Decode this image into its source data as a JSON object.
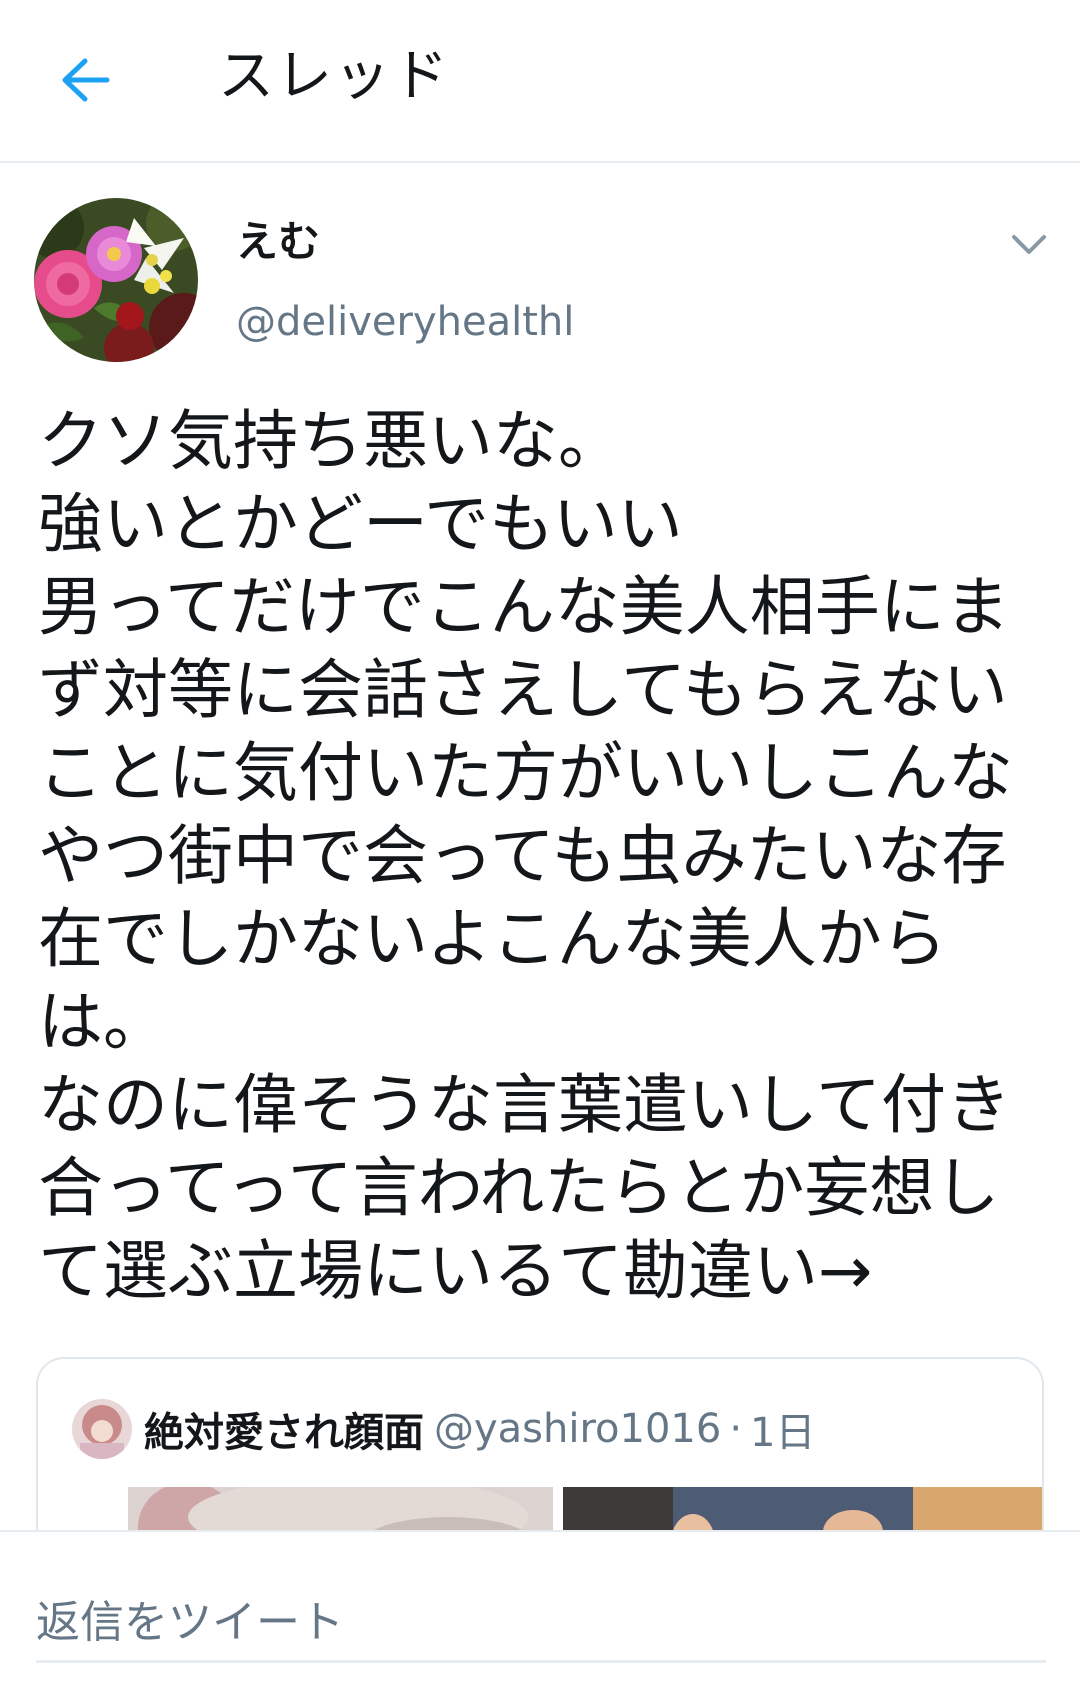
{
  "header": {
    "title": "スレッド",
    "back_icon": "arrow-left-icon",
    "accent_color": "#1da1f2"
  },
  "tweet": {
    "author": {
      "name": "えむ",
      "handle": "@deliveryhealthl",
      "avatar_icon": "flower-bouquet-avatar"
    },
    "menu_icon": "chevron-down-icon",
    "lines": [
      "クソ気持ち悪いな。",
      "強いとかどーでもいい",
      "男ってだけでこんな美人相手にま",
      "ず対等に会話さえしてもらえない",
      "ことに気付いた方がいいしこんな",
      "やつ街中で会っても虫みたいな存",
      "在でしかないよこんな美人から",
      "は。",
      "なのに偉そうな言葉遣いして付き",
      "合ってって言われたらとか妄想し",
      "て選ぶ立場にいるて勘違い→"
    ]
  },
  "quote": {
    "name": "絶対愛され顔面",
    "handle": "@yashiro1016",
    "dot": "·",
    "time": "1日"
  },
  "reply": {
    "placeholder": "返信をツイート"
  },
  "colors": {
    "text_primary": "#14171a",
    "text_secondary": "#657786",
    "border": "#e6ecf0"
  }
}
